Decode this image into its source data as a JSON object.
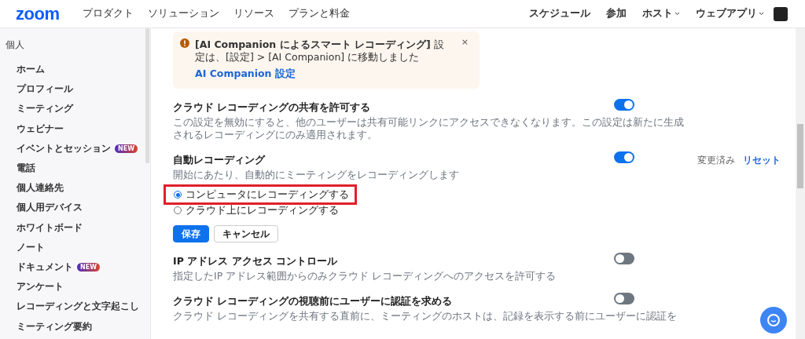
{
  "header": {
    "logo": "zoom",
    "nav": [
      "プロダクト",
      "ソリューション",
      "リソース",
      "プランと料金"
    ],
    "actions": [
      {
        "label": "スケジュール",
        "dropdown": false
      },
      {
        "label": "参加",
        "dropdown": false
      },
      {
        "label": "ホスト",
        "dropdown": true
      },
      {
        "label": "ウェブアプリ",
        "dropdown": true
      }
    ]
  },
  "sidebar": {
    "section": "個人",
    "items": [
      {
        "label": "ホーム"
      },
      {
        "label": "プロフィール"
      },
      {
        "label": "ミーティング"
      },
      {
        "label": "ウェビナー"
      },
      {
        "label": "イベントとセッション",
        "badge": "NEW"
      },
      {
        "label": "電話"
      },
      {
        "label": "個人連絡先"
      },
      {
        "label": "個人用デバイス"
      },
      {
        "label": "ホワイトボード"
      },
      {
        "label": "ノート"
      },
      {
        "label": "ドキュメント",
        "badge": "NEW"
      },
      {
        "label": "アンケート"
      },
      {
        "label": "レコーディングと文字起こし"
      },
      {
        "label": "ミーティング要約"
      }
    ]
  },
  "notice": {
    "text": "**[AI Companion によるスマート レコーディング]** 設定は、[設定] > [AI Companion] に移動しました",
    "link": "AI Companion 設定",
    "close": "×"
  },
  "settings": [
    {
      "title": "クラウド レコーディングの共有を許可する",
      "description": "この設定を無効にすると、他のユーザーは共有可能リンクにアクセスできなくなります。この設定は新たに生成されるレコーディングにのみ適用されます。",
      "on": true
    },
    {
      "title": "自動レコーディング",
      "description": "開始にあたり、自動的にミーティングをレコーディングします",
      "on": true,
      "modified": "変更済み",
      "reset": "リセット",
      "options": [
        {
          "label": "コンピュータにレコーディングする",
          "selected": true,
          "highlighted": true
        },
        {
          "label": "クラウド上にレコーディングする",
          "selected": false,
          "highlighted": false
        }
      ],
      "buttons": [
        {
          "label": "保存",
          "kind": "primary"
        },
        {
          "label": "キャンセル",
          "kind": "secondary"
        }
      ]
    },
    {
      "title": "IP アドレス アクセス コントロール",
      "description": "指定したIP アドレス範囲からのみクラウド レコーディングへのアクセスを許可する",
      "on": false
    },
    {
      "title": "クラウド レコーディングの視聴前にユーザーに認証を求める",
      "description": "クラウド レコーディングを共有する直前に、ミーティングのホストは、記録を表示する前にユーザーに認証を",
      "on": false
    }
  ]
}
